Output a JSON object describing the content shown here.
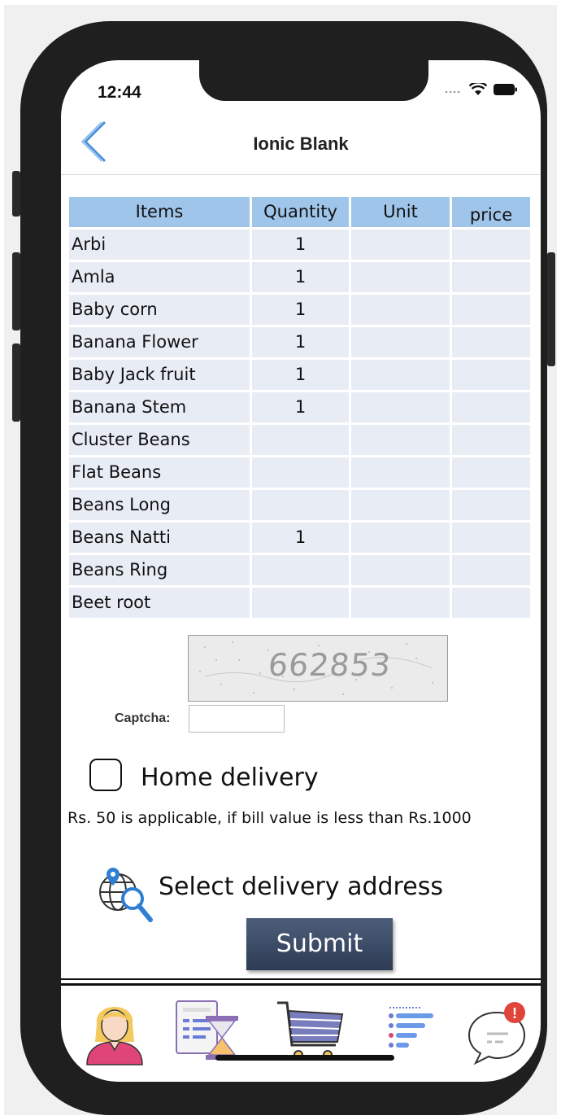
{
  "status_bar": {
    "time": "12:44"
  },
  "header": {
    "title": "Ionic Blank"
  },
  "table": {
    "columns": [
      "Items",
      "Quantity",
      "Unit",
      "price"
    ],
    "rows": [
      {
        "item": "Arbi",
        "quantity": "1",
        "unit": "",
        "price": ""
      },
      {
        "item": "Amla",
        "quantity": "1",
        "unit": "",
        "price": ""
      },
      {
        "item": "Baby corn",
        "quantity": "1",
        "unit": "",
        "price": ""
      },
      {
        "item": "Banana Flower",
        "quantity": "1",
        "unit": "",
        "price": ""
      },
      {
        "item": "Baby Jack fruit",
        "quantity": "1",
        "unit": "",
        "price": ""
      },
      {
        "item": "Banana Stem",
        "quantity": "1",
        "unit": "",
        "price": ""
      },
      {
        "item": "Cluster Beans",
        "quantity": "",
        "unit": "",
        "price": ""
      },
      {
        "item": "Flat Beans",
        "quantity": "",
        "unit": "",
        "price": ""
      },
      {
        "item": "Beans Long",
        "quantity": "",
        "unit": "",
        "price": ""
      },
      {
        "item": "Beans Natti",
        "quantity": "1",
        "unit": "",
        "price": ""
      },
      {
        "item": "Beans Ring",
        "quantity": "",
        "unit": "",
        "price": ""
      },
      {
        "item": "Beet root",
        "quantity": "",
        "unit": "",
        "price": ""
      }
    ]
  },
  "captcha": {
    "code": "662853",
    "label": "Captcha:",
    "input_value": ""
  },
  "delivery": {
    "home_delivery_label": "Home delivery",
    "home_delivery_checked": false,
    "note": "Rs. 50 is applicable, if bill value is less than Rs.1000",
    "select_address_label": "Select delivery address"
  },
  "submit_label": "Submit",
  "tabs": [
    {
      "icon": "user-profile-icon"
    },
    {
      "icon": "order-history-icon"
    },
    {
      "icon": "shopping-cart-icon"
    },
    {
      "icon": "list-icon"
    },
    {
      "icon": "chat-notification-icon",
      "badge": "!"
    }
  ],
  "colors": {
    "table_header": "#9fc5ea",
    "table_cell": "#e8ecf5",
    "submit": "#3a4a66",
    "back_arrow": "#4a90d9"
  }
}
